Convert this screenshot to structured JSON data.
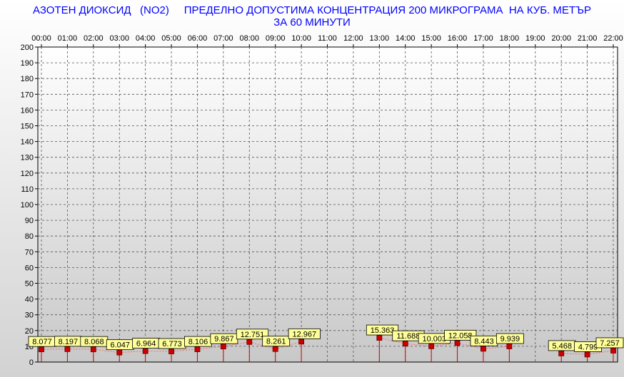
{
  "chart_data": {
    "type": "line",
    "title": "АЗОТЕН ДИОКСИД   (NO2)     ПРЕДЕЛНО ДОПУСТИМА КОНЦЕНТРАЦИЯ 200 МИКРОГРАМА  НА КУБ. МЕТЪР",
    "subtitle": "ЗА 60 МИНУТИ",
    "xlabel": "",
    "ylabel": "",
    "ylim": [
      0,
      200
    ],
    "y_ticks": [
      0,
      10,
      20,
      30,
      40,
      50,
      60,
      70,
      80,
      90,
      100,
      110,
      120,
      130,
      140,
      150,
      160,
      170,
      180,
      190,
      200
    ],
    "categories": [
      "00:00",
      "01:00",
      "02:00",
      "03:00",
      "04:00",
      "05:00",
      "06:00",
      "07:00",
      "08:00",
      "09:00",
      "10:00",
      "11:00",
      "12:00",
      "13:00",
      "14:00",
      "15:00",
      "16:00",
      "17:00",
      "18:00",
      "19:00",
      "20:00",
      "21:00",
      "22:00"
    ],
    "series": [
      {
        "values": [
          8.077,
          8.197,
          8.068,
          6.047,
          6.964,
          6.773,
          8.106,
          9.867,
          12.751,
          8.261,
          12.967,
          null,
          null,
          15.363,
          11.688,
          10.003,
          12.058,
          8.443,
          9.939,
          null,
          5.468,
          4.799,
          7.257
        ],
        "labels": [
          "8.077",
          "8.197",
          "8.068",
          "6.047",
          "6.964",
          "6.773",
          "8.106",
          "9.867",
          "12.751",
          "8.261",
          "12.967",
          "",
          "",
          "15.363",
          "11.688",
          "10.003",
          "12.058",
          "8.443",
          "9.939",
          "",
          "5.468",
          "4.799",
          "7.257"
        ],
        "color": "#cc0000"
      }
    ],
    "grid": true,
    "colors": {
      "title": "#0000ff",
      "marker": "#cc0000",
      "label_bg": "#ffff99",
      "plot_bg_top": "#ffffff",
      "plot_bg_bottom": "#c8c8c8"
    }
  }
}
